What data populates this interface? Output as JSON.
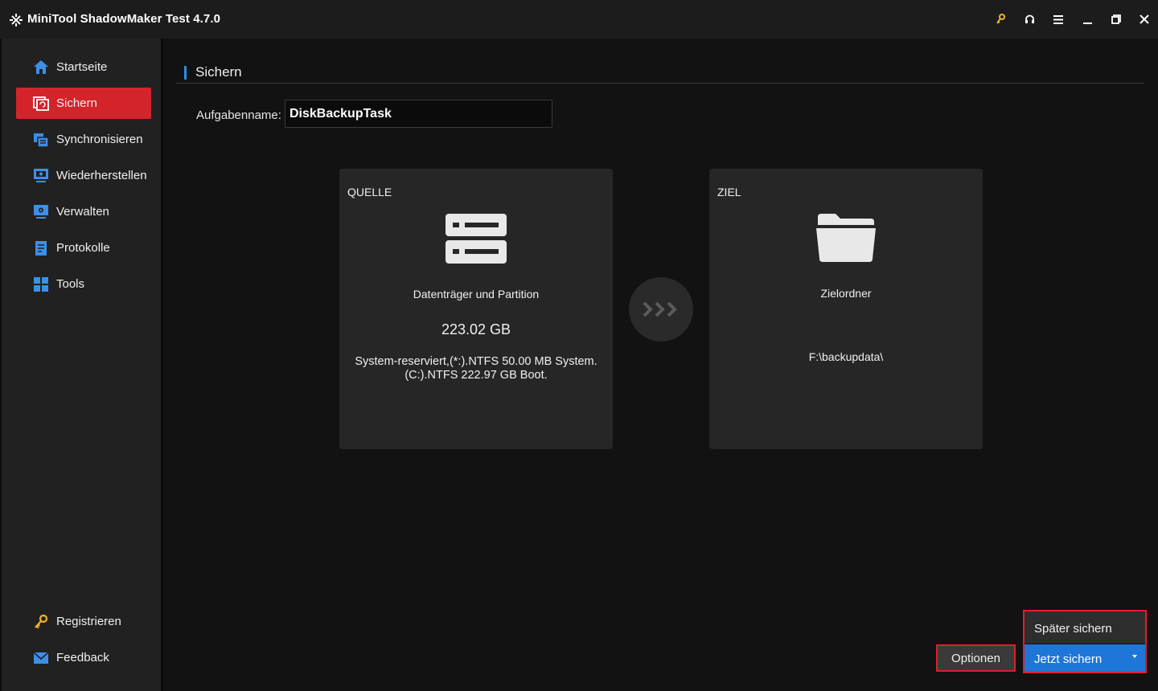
{
  "window": {
    "title": "MiniTool ShadowMaker Test 4.7.0",
    "controls": [
      "key-icon",
      "headset-icon",
      "menu-icon",
      "minimize-icon",
      "restore-icon",
      "close-icon"
    ]
  },
  "sidebar": {
    "items": [
      {
        "label": "Startseite",
        "icon": "home-icon",
        "active": false
      },
      {
        "label": "Sichern",
        "icon": "backup-icon",
        "active": true
      },
      {
        "label": "Synchronisieren",
        "icon": "sync-icon",
        "active": false
      },
      {
        "label": "Wiederherstellen",
        "icon": "restore-icon",
        "active": false
      },
      {
        "label": "Verwalten",
        "icon": "manage-icon",
        "active": false
      },
      {
        "label": "Protokolle",
        "icon": "logs-icon",
        "active": false
      },
      {
        "label": "Tools",
        "icon": "tools-icon",
        "active": false
      }
    ],
    "bottom": [
      {
        "label": "Registrieren",
        "icon": "key-icon"
      },
      {
        "label": "Feedback",
        "icon": "mail-icon"
      }
    ]
  },
  "main": {
    "section_title": "Sichern",
    "task": {
      "label": "Aufgabenname:",
      "value": "DiskBackupTask"
    },
    "source": {
      "heading": "QUELLE",
      "subtitle": "Datenträger und Partition",
      "size": "223.02 GB",
      "detail_line1": "System-reserviert,(*:).NTFS 50.00 MB System.",
      "detail_line2": "(C:).NTFS 222.97 GB Boot."
    },
    "destination": {
      "heading": "ZIEL",
      "subtitle": "Zielordner",
      "path": "F:\\backupdata\\"
    },
    "buttons": {
      "options": "Optionen",
      "later": "Später sichern",
      "now": "Jetzt sichern"
    }
  },
  "colors": {
    "accent_red": "#d3242b",
    "accent_blue": "#1e76d9",
    "highlight_outline": "#e01e2b",
    "icon_blue": "#3d8fe8",
    "icon_gold": "#f0b429"
  }
}
